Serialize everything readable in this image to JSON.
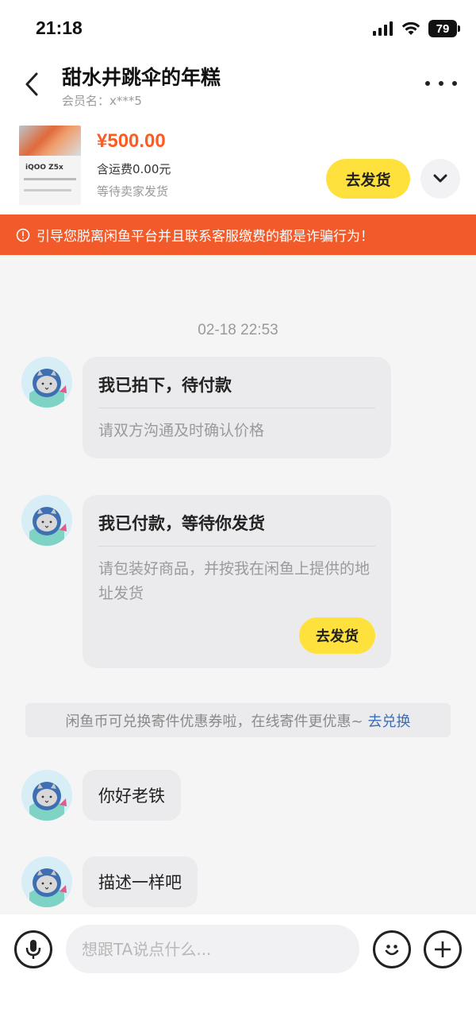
{
  "status_bar": {
    "time": "21:18",
    "battery": "79"
  },
  "header": {
    "title": "甜水井跳伞的年糕",
    "member": "会员名：x***5"
  },
  "order": {
    "thumb_brand": "iQOO Z5x",
    "price": "¥500.00",
    "shipping": "含运费0.00元",
    "status": "等待卖家发货",
    "ship_button": "去发货"
  },
  "warning": {
    "text": "引导您脱离闲鱼平台并且联系客服缴费的都是诈骗行为！"
  },
  "chat": {
    "timestamp": "02-18 22:53",
    "card1": {
      "title": "我已拍下，待付款",
      "desc": "请双方沟通及时确认价格"
    },
    "card2": {
      "title": "我已付款，等待你发货",
      "desc": "请包装好商品，并按我在闲鱼上提供的地址发货",
      "button": "去发货"
    },
    "notice": {
      "text": "闲鱼币可兑换寄件优惠券啦，在线寄件更优惠~",
      "link": "去兑换"
    },
    "messages": [
      "你好老铁",
      "描述一样吧"
    ]
  },
  "input": {
    "placeholder": "想跟TA说点什么..."
  },
  "colors": {
    "accent_yellow": "#ffe13d",
    "price_orange": "#ff5a1f",
    "warning_red": "#f25a2a",
    "link_blue": "#3b6fb5"
  },
  "icons": [
    "back-icon",
    "more-icon",
    "chevron-down-icon",
    "warning-icon",
    "voice-icon",
    "emoji-icon",
    "plus-icon",
    "signal-icon",
    "wifi-icon",
    "battery-icon"
  ]
}
